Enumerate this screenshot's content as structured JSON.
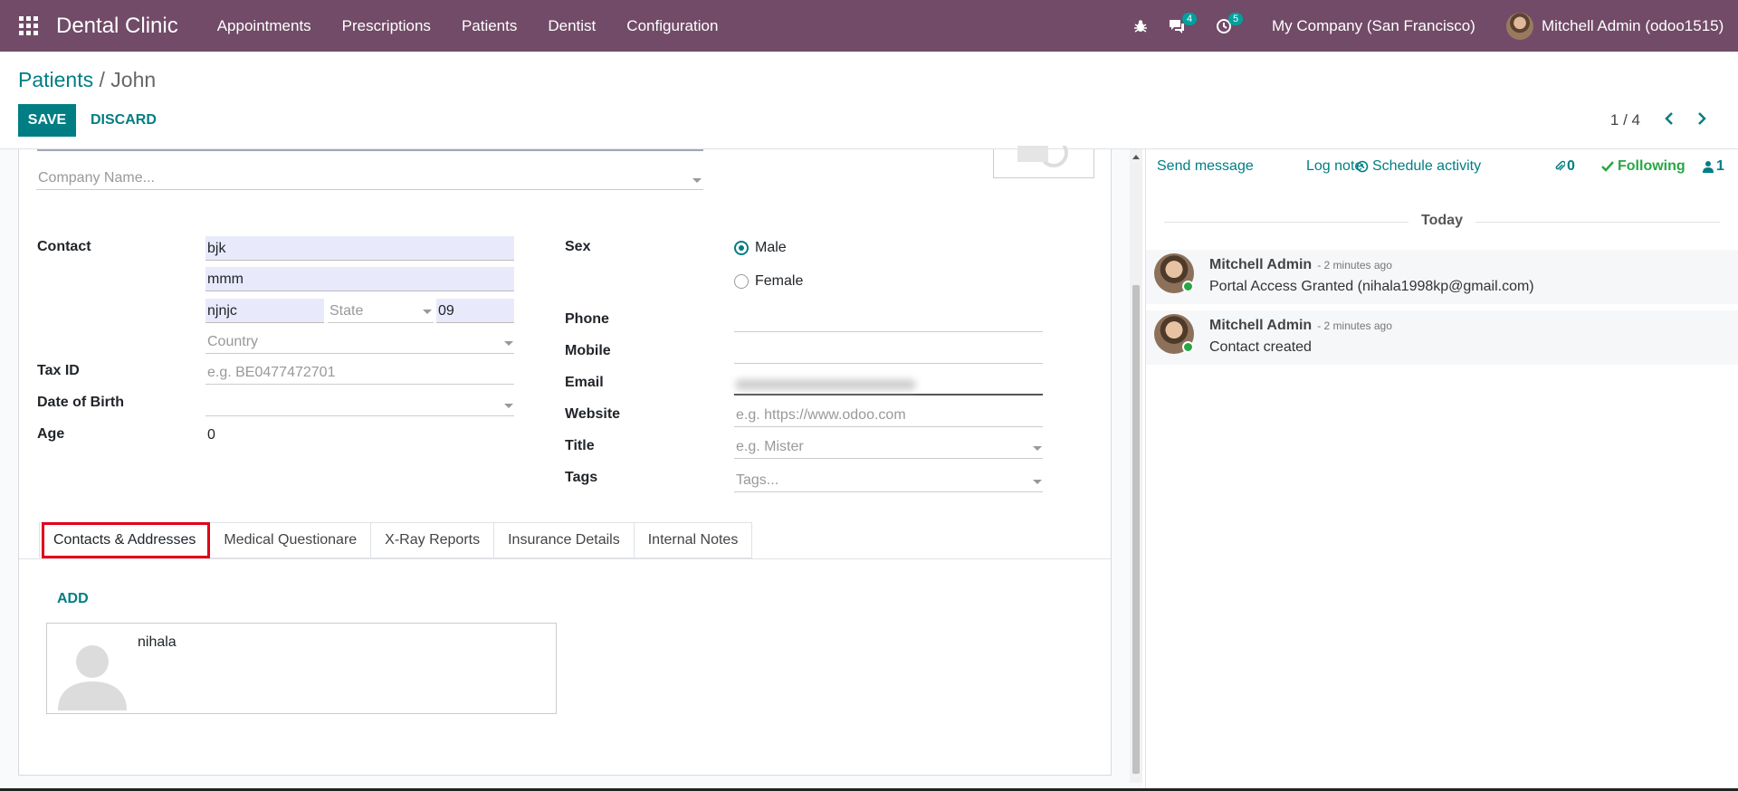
{
  "app": {
    "title": "Dental Clinic"
  },
  "nav": {
    "menus": [
      "Appointments",
      "Prescriptions",
      "Patients",
      "Dentist",
      "Configuration"
    ]
  },
  "systray": {
    "messages_count": "4",
    "activities_count": "5",
    "company": "My Company (San Francisco)",
    "user": "Mitchell Admin (odoo1515)"
  },
  "breadcrumb": {
    "parent": "Patients",
    "separator": " / ",
    "current": "John"
  },
  "buttons": {
    "save": "SAVE",
    "discard": "DISCARD"
  },
  "pager": {
    "value": "1 / 4"
  },
  "form": {
    "company_placeholder": "Company Name...",
    "contact_label": "Contact",
    "street": "bjk",
    "street2": "mmm",
    "city": "njnjc",
    "state_placeholder": "State",
    "zip": "09",
    "country_placeholder": "Country",
    "taxid_label": "Tax ID",
    "taxid_placeholder": "e.g. BE0477472701",
    "dob_label": "Date of Birth",
    "age_label": "Age",
    "age_value": "0",
    "sex_label": "Sex",
    "sex_male": "Male",
    "sex_female": "Female",
    "sex_selected": "Male",
    "phone_label": "Phone",
    "mobile_label": "Mobile",
    "email_label": "Email",
    "website_label": "Website",
    "website_placeholder": "e.g. https://www.odoo.com",
    "title_label": "Title",
    "title_placeholder": "e.g. Mister",
    "tags_label": "Tags",
    "tags_placeholder": "Tags..."
  },
  "tabs": [
    {
      "label": "Contacts & Addresses",
      "active": true
    },
    {
      "label": "Medical Questionare",
      "active": false
    },
    {
      "label": "X-Ray Reports",
      "active": false
    },
    {
      "label": "Insurance Details",
      "active": false
    },
    {
      "label": "Internal Notes",
      "active": false
    }
  ],
  "contacts": {
    "add_label": "ADD",
    "items": [
      {
        "name": "nihala"
      }
    ]
  },
  "chatter": {
    "send_message": "Send message",
    "log_note": "Log note",
    "schedule_activity": "Schedule activity",
    "attachments_count": "0",
    "following": "Following",
    "followers_count": "1",
    "date_separator": "Today",
    "messages": [
      {
        "author": "Mitchell Admin",
        "time": "- 2 minutes ago",
        "body": "Portal Access Granted (nihala1998kp@gmail.com)"
      },
      {
        "author": "Mitchell Admin",
        "time": "- 2 minutes ago",
        "body": "Contact created"
      }
    ]
  },
  "colors": {
    "brand": "#714b67",
    "accent": "#017e84",
    "highlight": "#e0001b"
  }
}
